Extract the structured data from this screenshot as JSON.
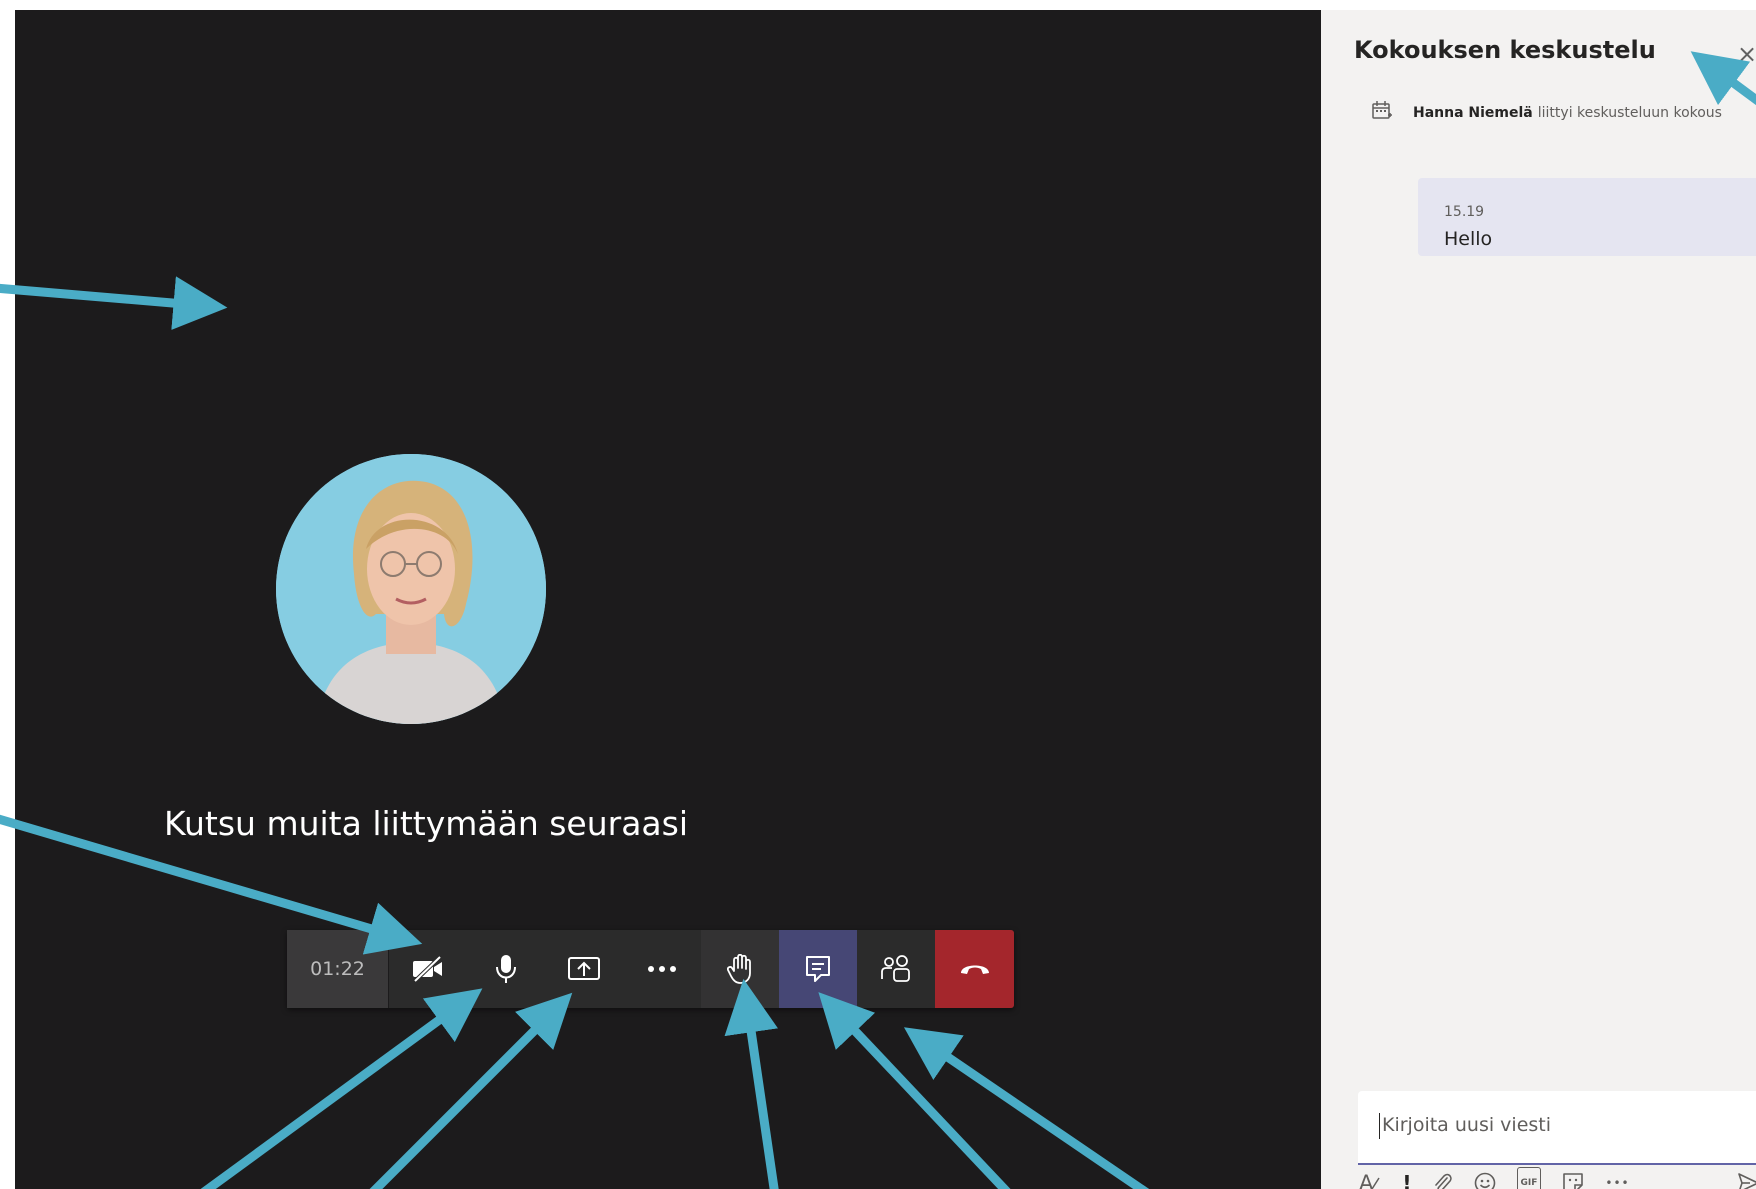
{
  "meeting": {
    "invite_text": "Kutsu muita liittymään seuraasi",
    "timer": "01:22"
  },
  "toolbar": {
    "icons": [
      "camera-off-icon",
      "microphone-icon",
      "share-screen-icon",
      "more-icon",
      "raise-hand-icon",
      "chat-icon",
      "participants-icon",
      "hang-up-icon"
    ],
    "colors": {
      "bar": "#2b2b2b",
      "chat_active": "#464775",
      "hangup": "#a4262c"
    }
  },
  "chat_panel": {
    "title": "Kokouksen keskustelu",
    "close_glyph": "×",
    "system_message": {
      "name": "Hanna Niemelä",
      "text": "liittyi keskusteluun kokous"
    },
    "message": {
      "time": "15.19",
      "text": "Hello"
    },
    "compose_placeholder": "Kirjoita uusi viesti",
    "format_icons": [
      "format-icon",
      "important-icon",
      "attach-icon",
      "emoji-icon",
      "gif-icon",
      "sticker-icon",
      "more-icon",
      "send-icon"
    ],
    "format_glyphs": {
      "format": "A",
      "important": "!",
      "gif": "GIF",
      "more": "•••"
    }
  },
  "annotation_color": "#4aacc6"
}
